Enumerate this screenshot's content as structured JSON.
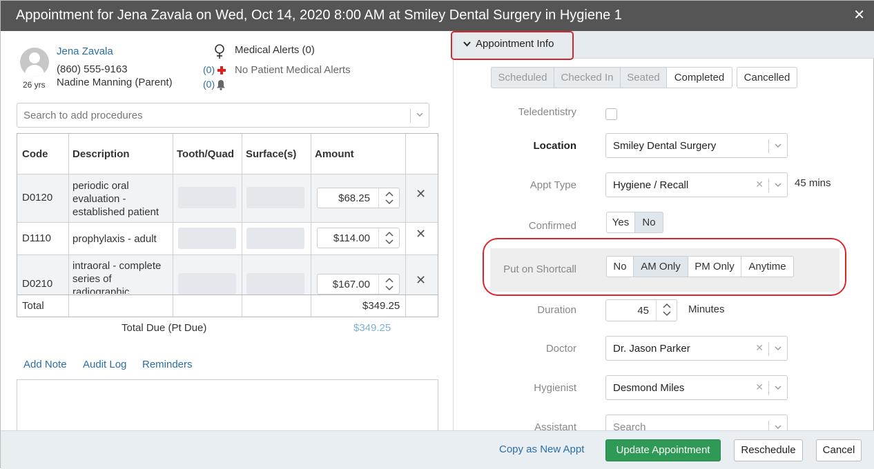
{
  "modal": {
    "title": "Appointment for Jena Zavala on Wed, Oct 14, 2020 8:00 AM at Smiley Dental Surgery in Hygiene 1",
    "close_glyph": "✕"
  },
  "patient": {
    "name": "Jena Zavala",
    "age": "26 yrs",
    "phone": "(860) 555-9163",
    "guardian": "Nadine Manning (Parent)"
  },
  "alerts": {
    "title": "Medical Alerts (0)",
    "medical_count": "(0)",
    "medical_text": "No Patient Medical Alerts",
    "notification_count": "(0)"
  },
  "procedures": {
    "search_placeholder": "Search to add procedures",
    "headers": [
      "Code",
      "Description",
      "Tooth/Quad",
      "Surface(s)",
      "Amount"
    ],
    "rows": [
      {
        "code": "D0120",
        "description": "periodic oral evaluation - established patient",
        "amount": "$68.25"
      },
      {
        "code": "D1110",
        "description": "prophylaxis - adult",
        "amount": "$114.00"
      },
      {
        "code": "D0210",
        "description": "intraoral - complete series of radiographic",
        "amount": "$167.00"
      }
    ],
    "total_label": "Total",
    "total_value": "$349.25",
    "total_due_label": "Total Due (Pt Due)",
    "total_due_value": "$349.25"
  },
  "notes": {
    "links": [
      "Add Note",
      "Audit Log",
      "Reminders"
    ]
  },
  "appointment_info": {
    "section_label": "Appointment Info",
    "status_options": [
      "Scheduled",
      "Checked In",
      "Seated",
      "Completed",
      "Cancelled"
    ],
    "teledentistry_label": "Teledentistry",
    "location_label": "Location",
    "location_value": "Smiley Dental Surgery",
    "appt_type_label": "Appt Type",
    "appt_type_value": "Hygiene / Recall",
    "appt_type_duration": "45 mins",
    "confirmed_label": "Confirmed",
    "confirmed_options": [
      "Yes",
      "No"
    ],
    "confirmed_selected": "No",
    "shortcall_label": "Put on Shortcall",
    "shortcall_options": [
      "No",
      "AM Only",
      "PM Only",
      "Anytime"
    ],
    "shortcall_selected": "AM Only",
    "duration_label": "Duration",
    "duration_value": "45",
    "duration_unit": "Minutes",
    "doctor_label": "Doctor",
    "doctor_value": "Dr. Jason Parker",
    "hygienist_label": "Hygienist",
    "hygienist_value": "Desmond Miles",
    "assistant_label": "Assistant",
    "assistant_placeholder": "Search"
  },
  "footer": {
    "copy_link": "Copy as New Appt",
    "update_button": "Update Appointment",
    "reschedule_button": "Reschedule",
    "cancel_button": "Cancel"
  },
  "colors": {
    "title_bar": "#555555",
    "link": "#2a6ea6",
    "primary_button": "#2e9a55",
    "highlight_box": "#d9262e",
    "alert_cross": "#e02020"
  },
  "icons": {
    "female": "female-icon",
    "medical_cross": "medical-cross-icon",
    "bell": "bell-icon",
    "chevron": "chevron-down-icon",
    "remove": "close-icon"
  }
}
